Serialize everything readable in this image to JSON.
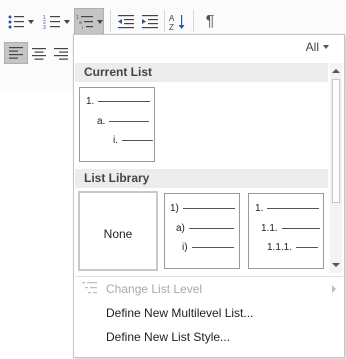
{
  "toolbar": {
    "icons": [
      "bullets-icon",
      "numbering-icon",
      "multilevel-list-icon",
      "decrease-indent-icon",
      "increase-indent-icon",
      "sort-icon",
      "show-formatting-marks-icon",
      "align-left-icon",
      "center-icon",
      "align-right-icon"
    ]
  },
  "filter": {
    "label": "All"
  },
  "sections": {
    "current": "Current List",
    "library": "List Library"
  },
  "current_list": {
    "levels": [
      "1.",
      "a.",
      "i."
    ]
  },
  "library": [
    {
      "kind": "none",
      "label": "None"
    },
    {
      "kind": "list",
      "levels": [
        "1)",
        "a)",
        "i)"
      ]
    },
    {
      "kind": "list",
      "levels": [
        "1.",
        "1.1.",
        "1.1.1."
      ]
    }
  ],
  "menu": {
    "change_level": "Change List Level",
    "define_multilevel": "Define New Multilevel List...",
    "define_style": "Define New List Style..."
  },
  "colors": {
    "accent": "#2b579a",
    "selected_tile_border": "#c8c8c8"
  }
}
